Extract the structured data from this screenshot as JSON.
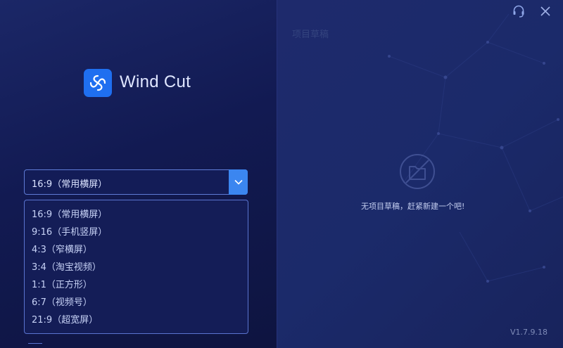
{
  "app": {
    "name": "Wind Cut",
    "version": "V1.7.9.18"
  },
  "aspect_select": {
    "selected": "16:9（常用横屏）",
    "options": [
      "16:9（常用横屏）",
      "9:16（手机竖屏）",
      "4:3（窄横屏）",
      "3:4（淘宝视频）",
      "1:1（正方形）",
      "6:7（视频号）",
      "21:9（超宽屏）"
    ]
  },
  "drafts": {
    "title": "项目草稿",
    "empty_message": "无项目草稿，赶紧新建一个吧!"
  },
  "icons": {
    "logo": "wind-cut-logo-icon",
    "support": "headset-icon",
    "close": "close-icon",
    "empty": "no-folder-icon",
    "dropdown": "chevron-down-icon"
  },
  "colors": {
    "accent": "#3b86f0",
    "logo_bg": "#1f6ff0",
    "background": "#16205a"
  }
}
